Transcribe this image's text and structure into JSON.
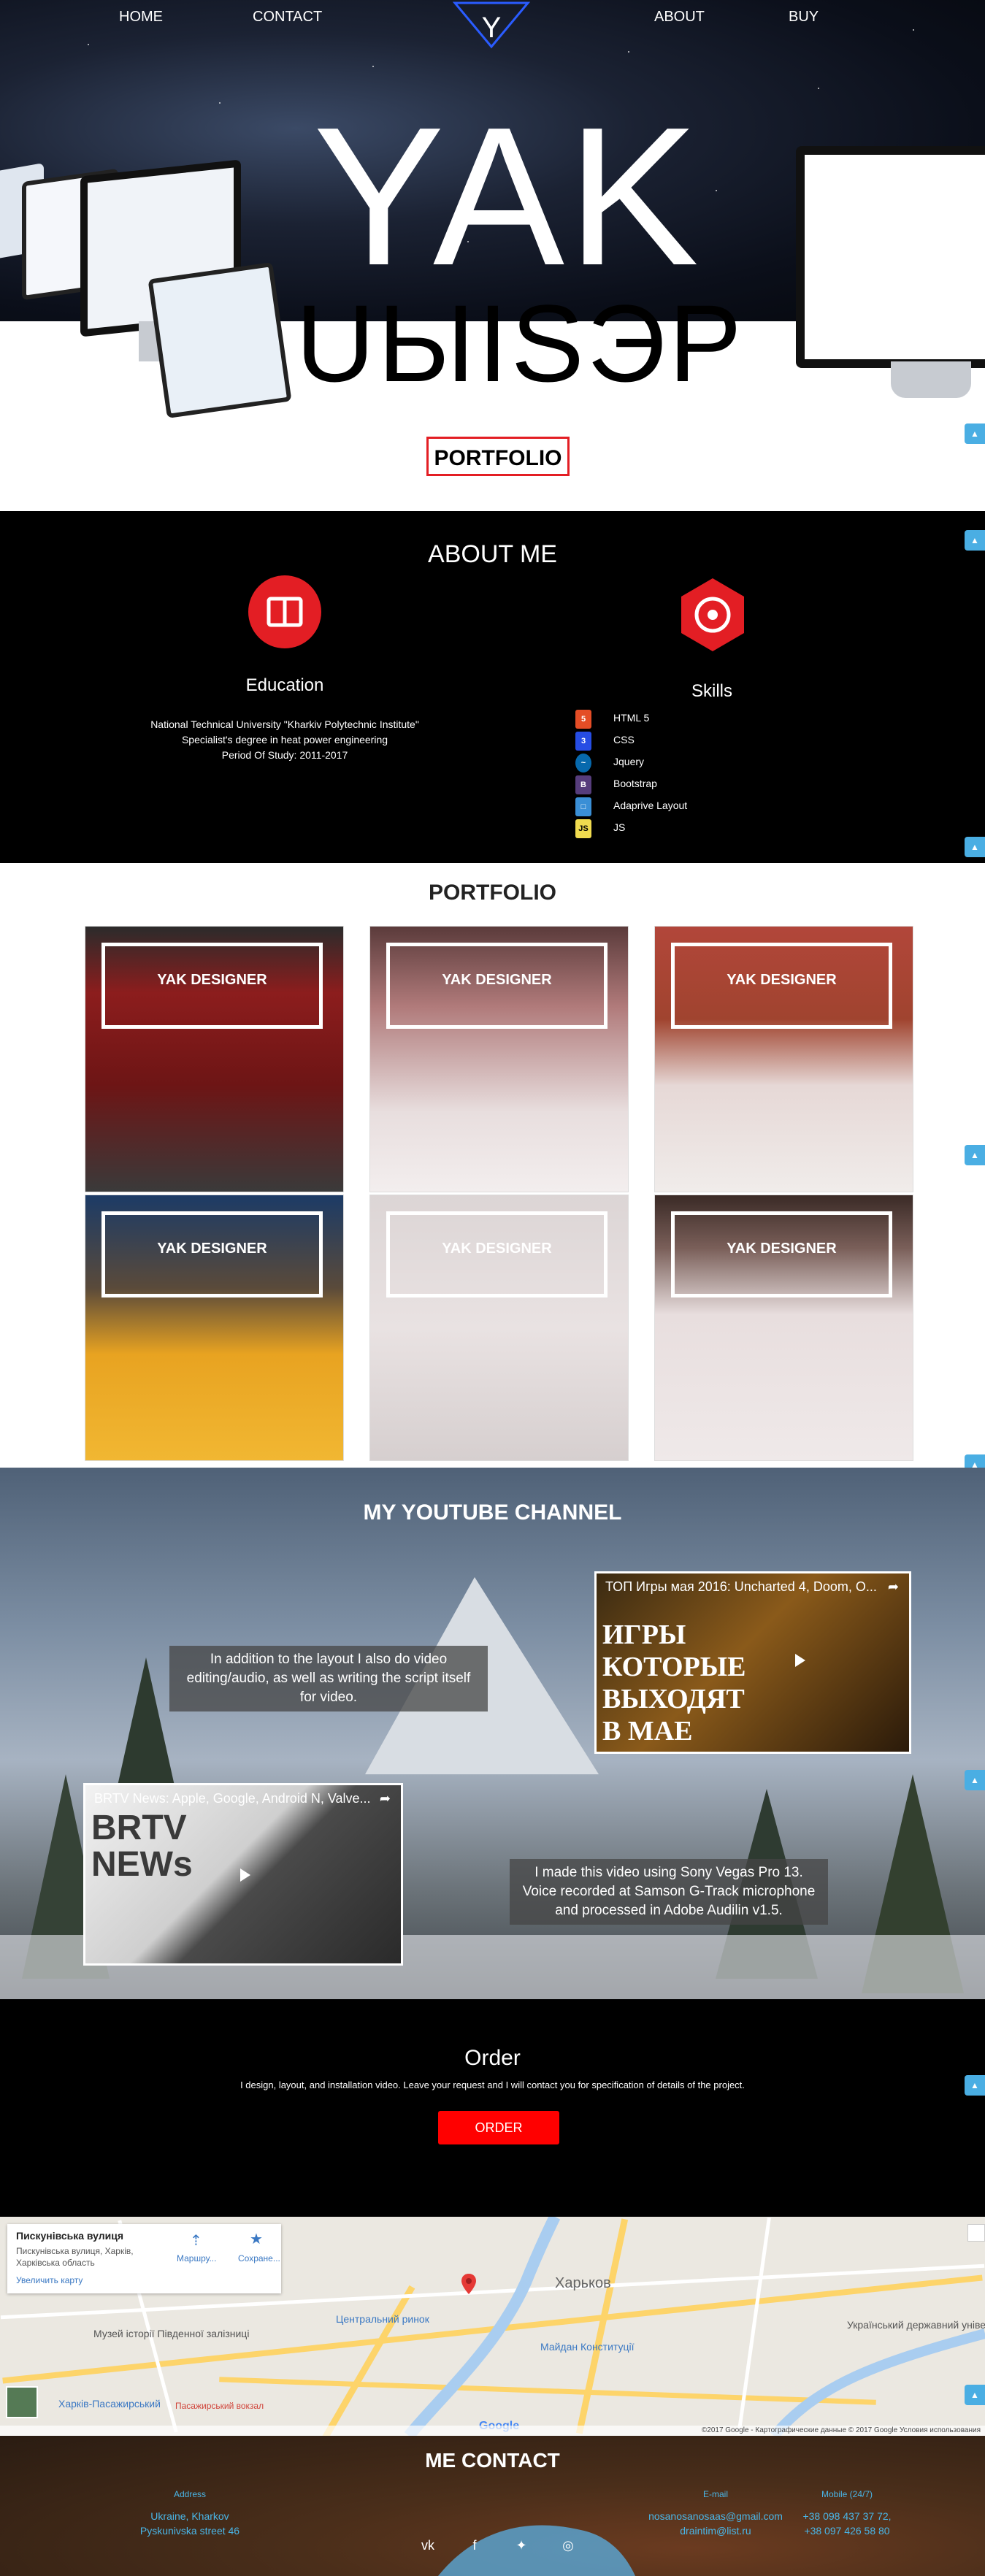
{
  "nav": {
    "home": "HOME",
    "contact": "CONTACT",
    "logo": "Y",
    "about": "ABOUT",
    "buy": "BUY"
  },
  "hero": {
    "title_line1": "YAK",
    "title_line2": "UЫISЭP",
    "portfolio_button": "PORTFOLIO"
  },
  "about": {
    "title": "ABOUT ME",
    "education": {
      "label": "Education",
      "lines": [
        "National Technical University \"Kharkiv Polytechnic Institute\"",
        "Specialist's degree in heat power engineering",
        "Period Of Study: 2011-2017"
      ]
    },
    "skills": {
      "label": "Skills",
      "items": [
        {
          "name": "HTML 5",
          "icon": "html5-icon",
          "color": "#e44d26"
        },
        {
          "name": "CSS",
          "icon": "css3-icon",
          "color": "#264de4"
        },
        {
          "name": "Jquery",
          "icon": "jquery-icon",
          "color": "#0769ad"
        },
        {
          "name": "Bootstrap",
          "icon": "bootstrap-icon",
          "color": "#563d7c"
        },
        {
          "name": "Adaprive Layout",
          "icon": "adaptive-icon",
          "color": "#3a8fd6"
        },
        {
          "name": "JS",
          "icon": "js-icon",
          "color": "#f0db4f"
        }
      ]
    }
  },
  "portfolio": {
    "title": "PORTFOLIO",
    "tiles": [
      {
        "label": "YAK DESIGNER",
        "theme": "car-service",
        "bg": "#8c1d1d"
      },
      {
        "label": "YAK DESIGNER",
        "theme": "hostel",
        "bg": "#b07a7a"
      },
      {
        "label": "YAK DESIGNER",
        "theme": "wood",
        "bg": "#b2463a"
      },
      {
        "label": "YAK DESIGNER",
        "theme": "merchant",
        "bg": "#1c3b66"
      },
      {
        "label": "YAK DESIGNER",
        "theme": "agency",
        "bg": "#dcd5d5"
      },
      {
        "label": "YAK DESIGNER",
        "theme": "geometria",
        "bg": "#3a2a26"
      }
    ]
  },
  "youtube": {
    "title": "MY YOUTUBE CHANNEL",
    "video1": {
      "title": "ТОП Игры мая 2016: Uncharted 4, Doom, O...",
      "thumb_text": [
        "ИГРЫ",
        "КОТОРЫЕ",
        "ВЫХОДЯТ",
        "В МАЕ"
      ]
    },
    "caption1": "In addition to the layout I also do video editing/audio, as well as writing the script itself for video.",
    "video2": {
      "title": "BRTV News: Apple, Google, Android N, Valve...",
      "thumb_text": [
        "BRTV",
        "NEWs"
      ]
    },
    "caption2": "I made this video using Sony Vegas Pro 13. Voice recorded at Samson G-Track microphone and processed in Adobe Audilin v1.5."
  },
  "order": {
    "title": "Order",
    "text": "I design, layout, and installation video. Leave your request and I will contact you for specification of details of the project.",
    "button": "ORDER"
  },
  "map": {
    "card_title": "Пискунівська вулиця",
    "card_line1": "Пискунівська вулиця, Харків,",
    "card_line2": "Харківська область",
    "card_link": "Увеличить карту",
    "route_label": "Маршру...",
    "save_label": "Сохране...",
    "city": "Харьков",
    "labels": [
      "Музей історії Південної залізниці",
      "Центральний ринок",
      "Харків-Пасажирський",
      "Пасажирський вокзал",
      "Український державний університет...",
      "Майдан Конституції"
    ],
    "footer_text": "©2017 Google - Картографические данные © 2017 Google   Условия использования",
    "google": "Google"
  },
  "contact": {
    "title": "ME CONTACT",
    "address_label": "Address",
    "address_lines": [
      "Ukraine, Kharkov",
      "Pyskunivska street 46"
    ],
    "email_label": "E-mail",
    "emails": [
      "nosanosanosaas@gmail.com",
      "draintim@list.ru"
    ],
    "mobile_label": "Mobile (24/7)",
    "phones": [
      "+38 098 437 37 72,",
      "+38 097 426 58 80"
    ],
    "socials": [
      "vk-icon",
      "facebook-icon",
      "twitter-icon",
      "instagram-icon"
    ]
  },
  "colors": {
    "accent_red": "#e31e24",
    "link_blue": "#49b6e8",
    "order_red": "#ff0000"
  }
}
